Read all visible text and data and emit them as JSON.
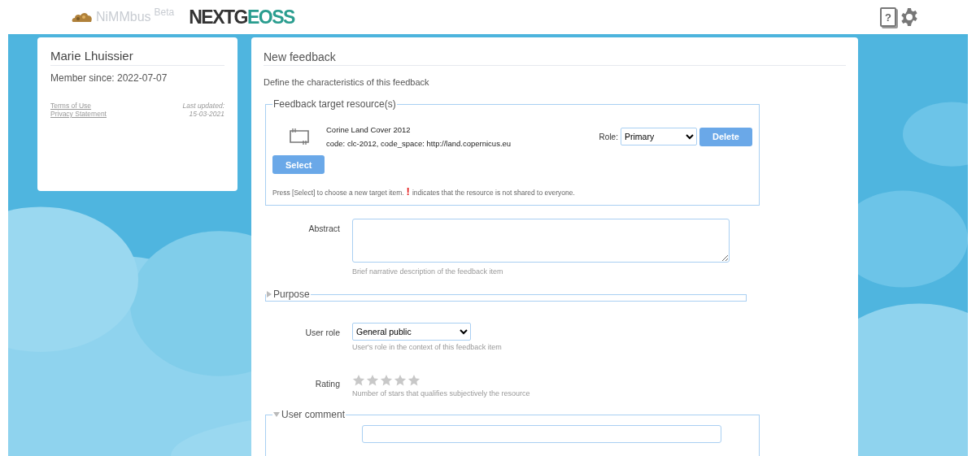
{
  "header": {
    "app_name": "NiMMbus",
    "app_badge": "Beta",
    "partner_logo": {
      "part1": "NEXTG",
      "part2": "EOSS"
    },
    "help_glyph": "?"
  },
  "profile": {
    "name": "Marie Lhuissier",
    "member_since": "Member since: 2022-07-07",
    "links": [
      "Terms of Use",
      "Privacy Statement"
    ],
    "last_updated_label": "Last updated:",
    "last_updated": "15-03-2021"
  },
  "form": {
    "title": "New feedback",
    "subtitle": "Define the characteristics of this feedback",
    "target": {
      "legend": "Feedback target resource(s)",
      "resource_title": "Corine Land Cover 2012",
      "resource_code": "code: clc-2012, code_space: http://land.copernicus.eu",
      "role_label": "Role:",
      "role_value": "Primary",
      "delete_button": "Delete",
      "select_button": "Select",
      "note_before": "Press [Select] to choose a new target item.",
      "note_mark": "!",
      "note_after": "indicates that the resource is not shared to everyone."
    },
    "abstract": {
      "label": "Abstract",
      "help": "Brief narrative description of the feedback item"
    },
    "purpose": {
      "legend": "Purpose",
      "expanded": false
    },
    "user_role": {
      "label": "User role",
      "value": "General public",
      "help": "User's role in the context of this feedback item"
    },
    "rating": {
      "label": "Rating",
      "stars": 0,
      "help": "Number of stars that qualifies subjectively the resource"
    },
    "user_comment": {
      "legend": "User comment",
      "expanded": true
    }
  }
}
